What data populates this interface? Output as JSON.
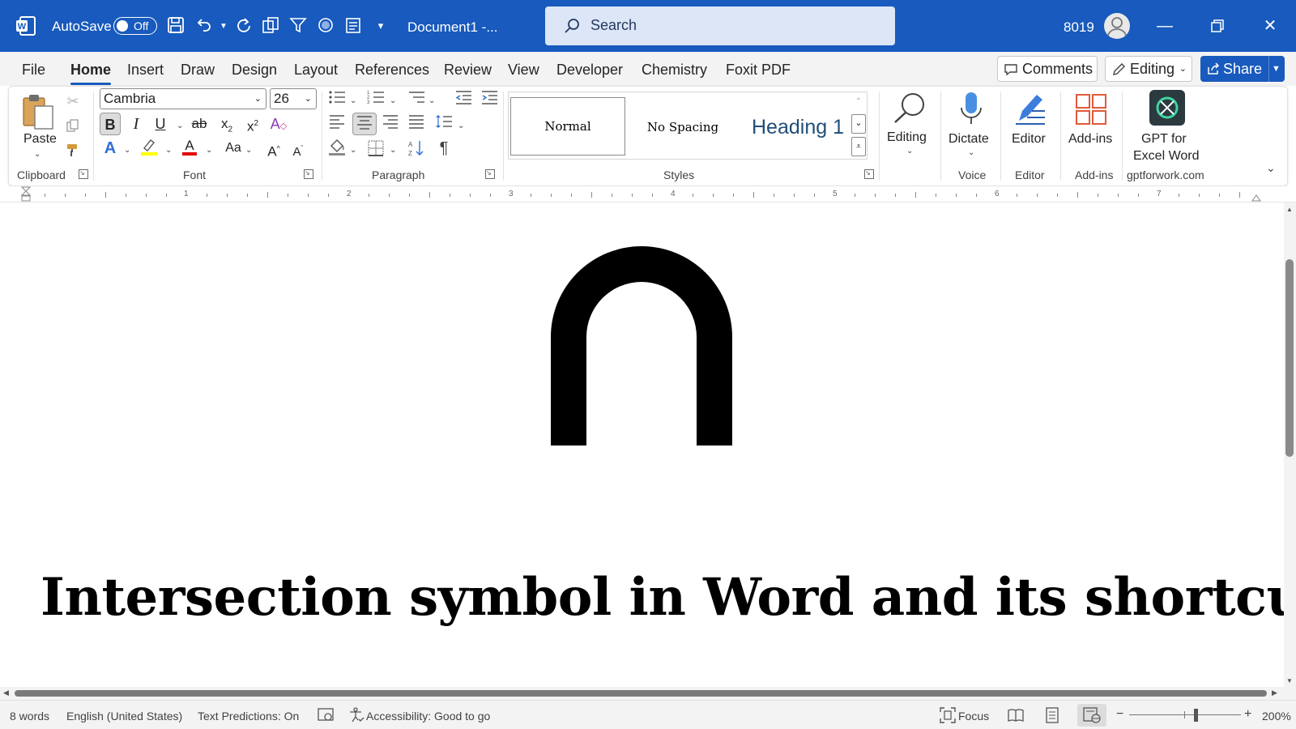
{
  "titlebar": {
    "autosave_label": "AutoSave",
    "autosave_state": "Off",
    "document_title": "Document1  -...",
    "search_placeholder": "Search",
    "user_name": "8019"
  },
  "menu": {
    "tabs": [
      "File",
      "Home",
      "Insert",
      "Draw",
      "Design",
      "Layout",
      "References",
      "Review",
      "View",
      "Developer",
      "Chemistry",
      "Foxit PDF"
    ],
    "active_tab": "Home",
    "comments_label": "Comments",
    "editing_label": "Editing",
    "share_label": "Share"
  },
  "ribbon": {
    "clipboard": {
      "paste_label": "Paste",
      "group_label": "Clipboard"
    },
    "font": {
      "font_name": "Cambria",
      "font_size": "26",
      "group_label": "Font"
    },
    "paragraph": {
      "group_label": "Paragraph"
    },
    "styles": {
      "normal": "Normal",
      "no_spacing": "No Spacing",
      "heading1": "Heading 1",
      "group_label": "Styles"
    },
    "editing": {
      "label": "Editing"
    },
    "voice": {
      "label": "Dictate",
      "group_label": "Voice"
    },
    "editor": {
      "label": "Editor",
      "group_label": "Editor"
    },
    "addins": {
      "label": "Add-ins",
      "group_label": "Add-ins"
    },
    "gpt": {
      "label_line1": "GPT for",
      "label_line2": "Excel Word",
      "group_label": "gptforwork.com"
    }
  },
  "ruler": {
    "numbers": [
      "1",
      "2",
      "3",
      "4",
      "5",
      "6",
      "7"
    ]
  },
  "document": {
    "symbol": "∩",
    "heading": "Intersection symbol in Word and its shortcut"
  },
  "status": {
    "word_count": "8 words",
    "language": "English (United States)",
    "text_predictions": "Text Predictions: On",
    "accessibility": "Accessibility: Good to go",
    "focus": "Focus",
    "zoom": "200%"
  },
  "colors": {
    "brand": "#185abd",
    "active_tab_underline": "#185abd",
    "heading1_text": "#1f4e79"
  }
}
